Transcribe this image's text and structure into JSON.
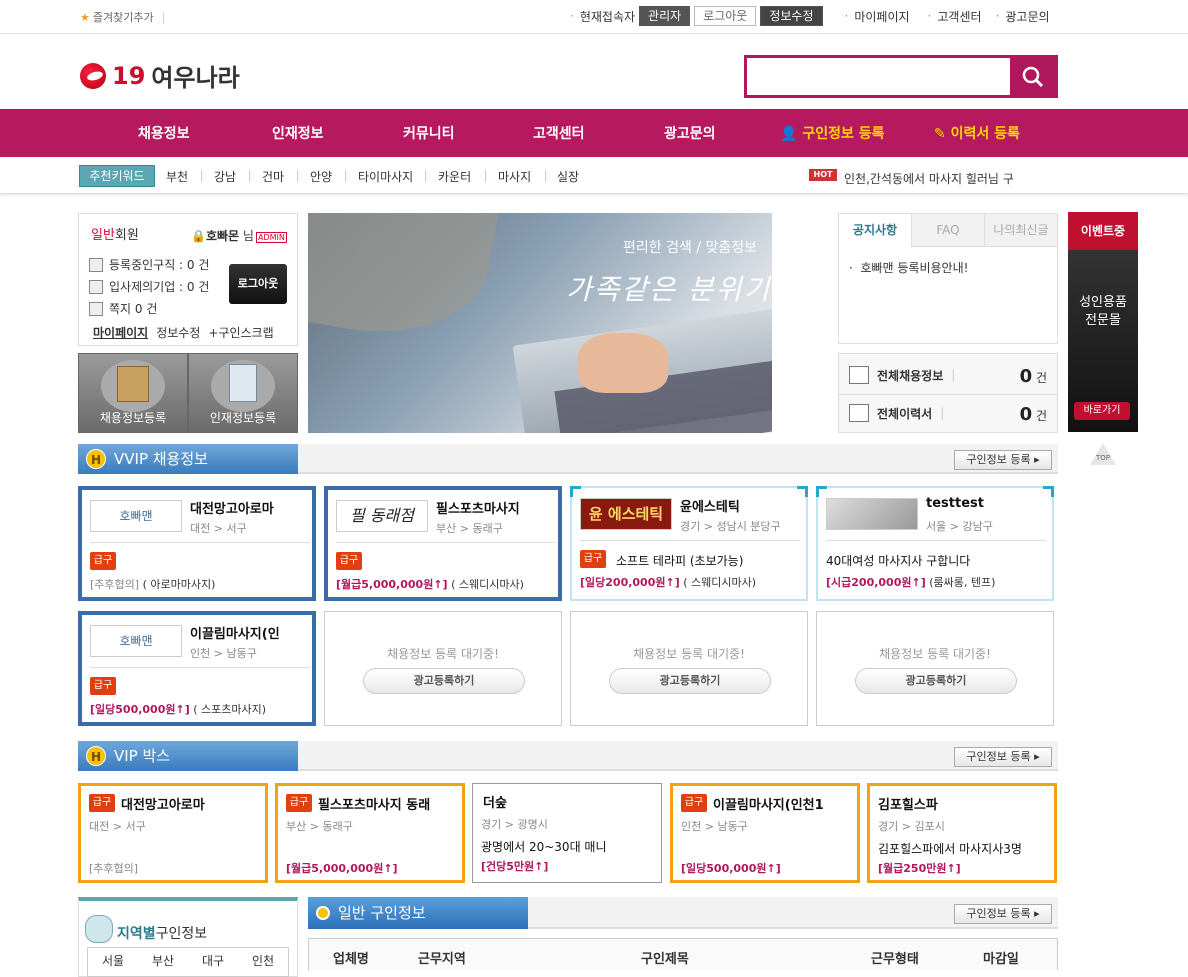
{
  "topbar": {
    "favorite": "즐겨찾기추가",
    "links": [
      "현재접속자",
      "마이페이지",
      "고객센터",
      "광고문의"
    ],
    "buttons": {
      "admin": "관리자",
      "logout": "로그아웃",
      "edit": "정보수정"
    }
  },
  "header": {
    "logo_num": "19",
    "logo_name": "여우나라",
    "search_placeholder": ""
  },
  "nav": [
    "채용정보",
    "인재정보",
    "커뮤니티",
    "고객센터",
    "광고문의",
    "구인정보 등록",
    "이력서 등록"
  ],
  "keywords": {
    "tag": "추천키워드",
    "items": [
      "부천",
      "강남",
      "건마",
      "안양",
      "타이마사지",
      "카운터",
      "마사지",
      "실장"
    ],
    "hot_badge": "HOT",
    "hot_text": "인천,간석동에서 마사지 힐러님 구"
  },
  "member": {
    "level_red": "일반",
    "level": "회원",
    "nick": "호빠몬",
    "nim": "님",
    "badge": "ADMIN",
    "rows": [
      "등록중인구직 : 0 건",
      "입사제의기업 : 0 건",
      "쪽지 0 건"
    ],
    "logout": "로그아웃",
    "mypage": "마이페이지",
    "edit": "정보수정",
    "scrap": "+구인스크랩",
    "reg_job": "채용정보등록",
    "reg_talent": "인재정보등록"
  },
  "banner": {
    "sub": "편리한 검색 / 맞춤정보",
    "main": "가족같은 분위기"
  },
  "notice": {
    "tabs": [
      "공지사항",
      "FAQ",
      "나의최신글"
    ],
    "items": [
      "호빠맨 등록비용안내!"
    ]
  },
  "stats": {
    "jobs_label": "전체채용정보",
    "jobs_count": "0",
    "resume_label": "전체이력서",
    "resume_count": "0",
    "unit": "건"
  },
  "event": {
    "head": "이벤트중",
    "text1": "성인용품",
    "text2": "전문몰",
    "go": "바로가기",
    "top": "TOP"
  },
  "vvip": {
    "title": "VVIP 채용정보",
    "reg": "구인정보 등록",
    "cards": [
      {
        "thumb": "호빠맨",
        "name": "대전망고아로마",
        "loc": "대전 > 서구",
        "urg": "급구",
        "desc": "",
        "pay_money": "",
        "pay_text": "[추후협의]",
        "pay_type": "( 아로마마사지)"
      },
      {
        "thumb": "필 동래점",
        "name": "필스포츠마사지",
        "loc": "부산 > 동래구",
        "urg": "급구",
        "desc": "",
        "pay_money": "[월급5,000,000원↑]",
        "pay_text": "",
        "pay_type": "( 스웨디시마사)"
      },
      {
        "thumb": "윤 에스테틱",
        "name": "윤에스테틱",
        "loc": "경기 > 성남시 분당구",
        "urg": "급구",
        "desc": "소프트 테라피 (초보가능)",
        "pay_money": "[일당200,000원↑]",
        "pay_text": "",
        "pay_type": "( 스웨디시마사)"
      },
      {
        "thumb": "",
        "name": "testtest",
        "loc": "서울 > 강남구",
        "urg": "",
        "desc": "40대여성 마사지사 구합니다",
        "pay_money": "[시급200,000원↑]",
        "pay_text": "",
        "pay_type": "(룸싸롱, 텐프)"
      },
      {
        "thumb": "호빠맨",
        "name": "이끌림마사지(인",
        "loc": "인천 > 남동구",
        "urg": "급구",
        "desc": "",
        "pay_money": "[일당500,000원↑]",
        "pay_text": "",
        "pay_type": "( 스포츠마사지)"
      }
    ],
    "wait_text": "채용정보 등록 대기중!",
    "ad_btn": "광고등록하기"
  },
  "vip": {
    "title": "VIP 박스",
    "reg": "구인정보 등록",
    "boxes": [
      {
        "urg": "급구",
        "name": "대전망고아로마",
        "loc": "대전 > 서구",
        "desc": "",
        "pay": "[추후협의]",
        "money": false
      },
      {
        "urg": "급구",
        "name": "필스포츠마사지 동래",
        "loc": "부산 > 동래구",
        "desc": "",
        "pay": "[월급5,000,000원↑]",
        "money": true
      },
      {
        "urg": "",
        "name": "더숲",
        "loc": "경기 > 광명시",
        "desc": "광명에서 20~30대 매니",
        "pay": "[건당5만원↑]",
        "money": true
      },
      {
        "urg": "급구",
        "name": "이끌림마사지(인천1",
        "loc": "인천 > 남동구",
        "desc": "",
        "pay": "[일당500,000원↑]",
        "money": true
      },
      {
        "urg": "",
        "name": "김포힐스파",
        "loc": "경기 > 김포시",
        "desc": "김포힐스파에서 마사지사3명",
        "pay": "[월급250만원↑]",
        "money": true
      }
    ]
  },
  "region": {
    "title_bold": "지역별",
    "title": "구인정보",
    "tabs": [
      "서울",
      "부산",
      "대구",
      "인천"
    ]
  },
  "general": {
    "title": "일반 구인정보",
    "reg": "구인정보 등록",
    "columns": [
      "업체명",
      "근무지역",
      "구인제목",
      "근무형태",
      "마감일"
    ]
  }
}
